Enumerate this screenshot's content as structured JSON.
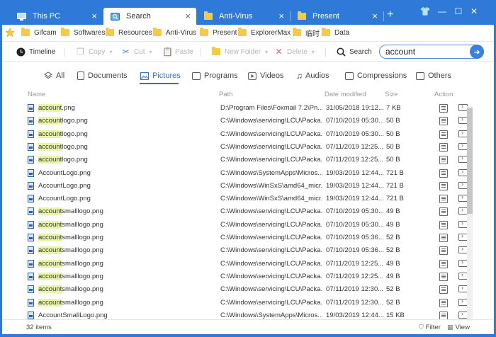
{
  "tabs": [
    {
      "label": "This PC",
      "icon": "computer-icon",
      "close": "×"
    },
    {
      "label": "Search",
      "icon": "search-tab-icon",
      "close": "×",
      "active": true
    },
    {
      "label": "Anti-Virus",
      "icon": "folder-icon",
      "close": "×"
    },
    {
      "label": "Present",
      "icon": "folder-icon",
      "close": "×"
    }
  ],
  "new_tab": "+",
  "window_controls": {
    "theme": "👕",
    "minimize": "—",
    "maximize": "☐",
    "close": "✕"
  },
  "bookmarks": [
    "Gifcam",
    "Softwares",
    "Resources",
    "Anti-Virus",
    "Present",
    "ExplorerMax",
    "临时",
    "Data"
  ],
  "toolbar": {
    "timeline": "Timeline",
    "copy": "Copy",
    "cut": "Cut",
    "paste": "Paste",
    "new_folder": "New Folder",
    "delete": "Delete",
    "search": "Search",
    "search_value": "account"
  },
  "categories": [
    "All",
    "Documents",
    "Pictures",
    "Programs",
    "Videos",
    "Audios",
    "Compressions",
    "Others"
  ],
  "active_category": "Pictures",
  "columns": {
    "name": "Name",
    "path": "Path",
    "date": "Date modified",
    "size": "Size",
    "action": "Action"
  },
  "rows": [
    {
      "hl": "account",
      "rest": ".png",
      "path": "D:\\Program Files\\Foxmail 7.2\\Pn...",
      "date": "31/05/2018 19:12...",
      "size": "7 KB"
    },
    {
      "hl": "account",
      "rest": "logo.png",
      "path": "C:\\Windows\\servicing\\LCU\\Packa...",
      "date": "07/10/2019 05:30...",
      "size": "50 B"
    },
    {
      "hl": "account",
      "rest": "logo.png",
      "path": "C:\\Windows\\servicing\\LCU\\Packa...",
      "date": "07/10/2019 05:30...",
      "size": "50 B"
    },
    {
      "hl": "account",
      "rest": "logo.png",
      "path": "C:\\Windows\\servicing\\LCU\\Packa...",
      "date": "07/11/2019 12:25...",
      "size": "50 B"
    },
    {
      "hl": "account",
      "rest": "logo.png",
      "path": "C:\\Windows\\servicing\\LCU\\Packa...",
      "date": "07/11/2019 12:25...",
      "size": "50 B"
    },
    {
      "hl": "",
      "rest": "AccountLogo.png",
      "path": "C:\\Windows\\SystemApps\\Micros...",
      "date": "19/03/2019 12:44...",
      "size": "721 B"
    },
    {
      "hl": "",
      "rest": "AccountLogo.png",
      "path": "C:\\Windows\\WinSxS\\amd64_micr...",
      "date": "19/03/2019 12:44...",
      "size": "721 B"
    },
    {
      "hl": "",
      "rest": "AccountLogo.png",
      "path": "C:\\Windows\\WinSxS\\amd64_micr...",
      "date": "19/03/2019 12:44...",
      "size": "721 B"
    },
    {
      "hl": "account",
      "rest": "smalllogo.png",
      "path": "C:\\Windows\\servicing\\LCU\\Packa...",
      "date": "07/10/2019 05:30...",
      "size": "49 B"
    },
    {
      "hl": "account",
      "rest": "smalllogo.png",
      "path": "C:\\Windows\\servicing\\LCU\\Packa...",
      "date": "07/10/2019 05:30...",
      "size": "49 B"
    },
    {
      "hl": "account",
      "rest": "smalllogo.png",
      "path": "C:\\Windows\\servicing\\LCU\\Packa...",
      "date": "07/10/2019 05:36...",
      "size": "52 B"
    },
    {
      "hl": "account",
      "rest": "smalllogo.png",
      "path": "C:\\Windows\\servicing\\LCU\\Packa...",
      "date": "07/10/2019 05:36...",
      "size": "52 B"
    },
    {
      "hl": "account",
      "rest": "smalllogo.png",
      "path": "C:\\Windows\\servicing\\LCU\\Packa...",
      "date": "07/11/2019 12:25...",
      "size": "49 B"
    },
    {
      "hl": "account",
      "rest": "smalllogo.png",
      "path": "C:\\Windows\\servicing\\LCU\\Packa...",
      "date": "07/11/2019 12:25...",
      "size": "49 B"
    },
    {
      "hl": "account",
      "rest": "smalllogo.png",
      "path": "C:\\Windows\\servicing\\LCU\\Packa...",
      "date": "07/11/2019 12:30...",
      "size": "52 B"
    },
    {
      "hl": "account",
      "rest": "smalllogo.png",
      "path": "C:\\Windows\\servicing\\LCU\\Packa...",
      "date": "07/11/2019 12:30...",
      "size": "52 B"
    },
    {
      "hl": "",
      "rest": "AccountSmallLogo.png",
      "path": "C:\\Windows\\SystemApps\\Micros...",
      "date": "19/03/2019 12:44...",
      "size": "15 KB"
    }
  ],
  "status": {
    "count": "32 items",
    "filter": "Filter",
    "view": "View"
  },
  "colors": {
    "accent": "#2c6fd1",
    "titlebar": "#2f7ad8",
    "highlight": "#e9f5a6",
    "folder": "#f7c948"
  }
}
